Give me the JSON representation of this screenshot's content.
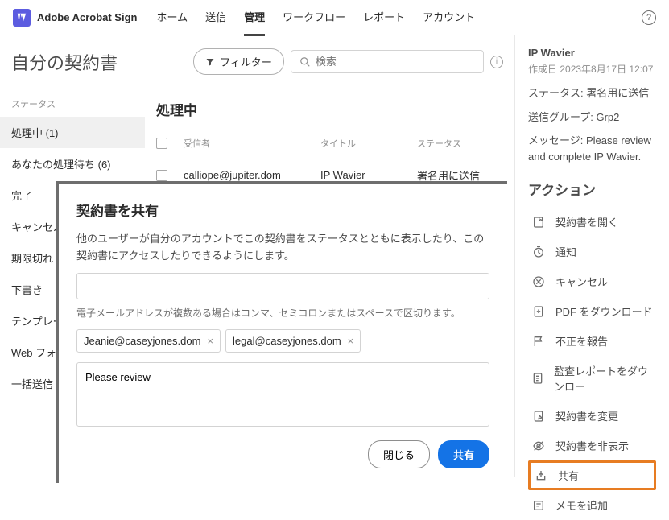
{
  "brand": "Adobe Acrobat Sign",
  "nav": {
    "items": [
      "ホーム",
      "送信",
      "管理",
      "ワークフロー",
      "レポート",
      "アカウント"
    ],
    "active_index": 2
  },
  "page_title": "自分の契約書",
  "filter_label": "フィルター",
  "search_placeholder": "検索",
  "sidebar": {
    "label": "ステータス",
    "items": [
      "処理中 (1)",
      "あなたの処理待ち (6)",
      "完了",
      "キャンセル済",
      "期限切れ",
      "下書き",
      "テンプレー",
      "Web フォー",
      "一括送信"
    ],
    "selected_index": 0
  },
  "section_title": "処理中",
  "table": {
    "headers": {
      "recipient": "受信者",
      "title": "タイトル",
      "status": "ステータス"
    },
    "rows": [
      {
        "recipient": "calliope@jupiter.dom",
        "title": "IP Wavier",
        "status": "署名用に送信"
      }
    ]
  },
  "details": {
    "title": "IP Wavier",
    "created_label": "作成日",
    "created_value": "2023年8月17日 12:07",
    "status_label": "ステータス:",
    "status_value": "署名用に送信",
    "group_label": "送信グループ:",
    "group_value": "Grp2",
    "message_label": "メッセージ:",
    "message_value": "Please review and complete IP Wavier."
  },
  "actions": {
    "title": "アクション",
    "items": [
      {
        "icon": "open",
        "label": "契約書を開く"
      },
      {
        "icon": "clock",
        "label": "通知"
      },
      {
        "icon": "cancel",
        "label": "キャンセル"
      },
      {
        "icon": "download",
        "label": "PDF をダウンロード"
      },
      {
        "icon": "flag",
        "label": "不正を報告"
      },
      {
        "icon": "audit",
        "label": "監査レポートをダウンロー"
      },
      {
        "icon": "modify",
        "label": "契約書を変更"
      },
      {
        "icon": "hide",
        "label": "契約書を非表示"
      },
      {
        "icon": "share",
        "label": "共有",
        "highlighted": true
      },
      {
        "icon": "note",
        "label": "メモを追加"
      }
    ]
  },
  "modal": {
    "title": "契約書を共有",
    "description": "他のユーザーが自分のアカウントでこの契約書をステータスとともに表示したり、この契約書にアクセスしたりできるようにします。",
    "hint": "電子メールアドレスが複数ある場合はコンマ、セミコロンまたはスペースで区切ります。",
    "chips": [
      "Jeanie@caseyjones.dom",
      "legal@caseyjones.dom"
    ],
    "message_value": "Please review",
    "close_label": "閉じる",
    "share_label": "共有"
  }
}
